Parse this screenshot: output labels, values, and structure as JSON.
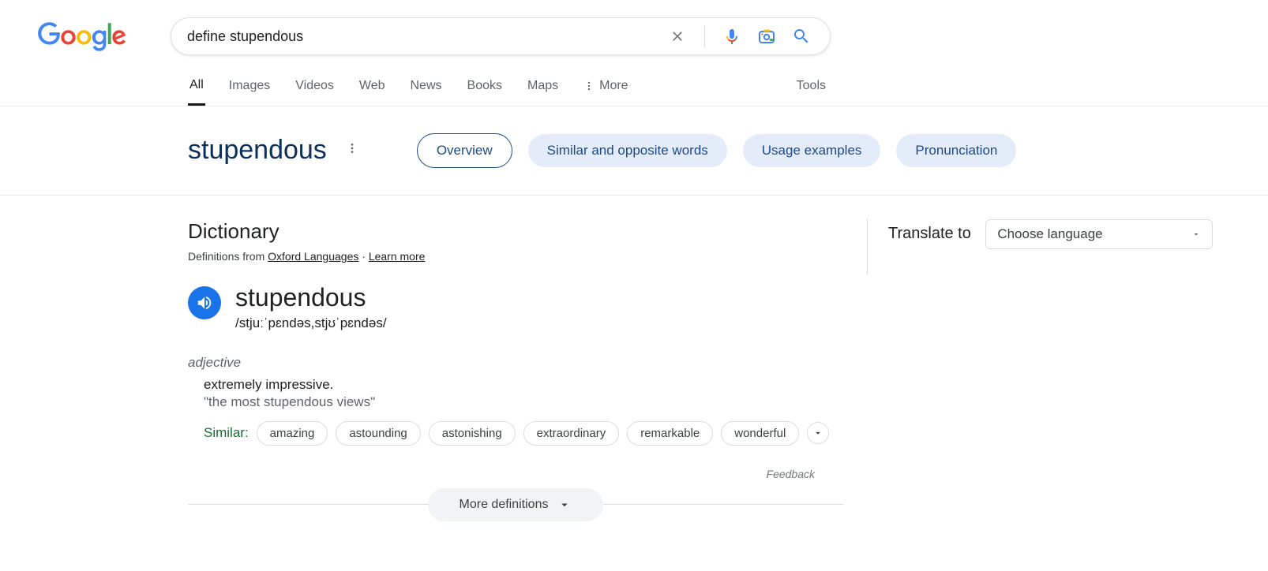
{
  "search": {
    "query": "define stupendous"
  },
  "tabs": {
    "all": "All",
    "images": "Images",
    "videos": "Videos",
    "web": "Web",
    "news": "News",
    "books": "Books",
    "maps": "Maps",
    "more": "More",
    "tools": "Tools"
  },
  "wordStrip": {
    "word": "stupendous",
    "chips": {
      "overview": "Overview",
      "similar": "Similar and opposite words",
      "usage": "Usage examples",
      "pronunciation": "Pronunciation"
    }
  },
  "dictionary": {
    "title": "Dictionary",
    "source_prefix": "Definitions from ",
    "source_link": "Oxford Languages",
    "separator": " · ",
    "learn_more": "Learn more",
    "word": "stupendous",
    "pronunciation": "/stjuːˈpɛndəs,stjʊˈpɛndəs/",
    "pos": "adjective",
    "definition": "extremely impressive.",
    "example": "\"the most stupendous views\"",
    "similar_label": "Similar:",
    "synonyms": [
      "amazing",
      "astounding",
      "astonishing",
      "extraordinary",
      "remarkable",
      "wonderful"
    ],
    "feedback": "Feedback",
    "more_defs": "More definitions"
  },
  "translate": {
    "label": "Translate to",
    "placeholder": "Choose language"
  }
}
